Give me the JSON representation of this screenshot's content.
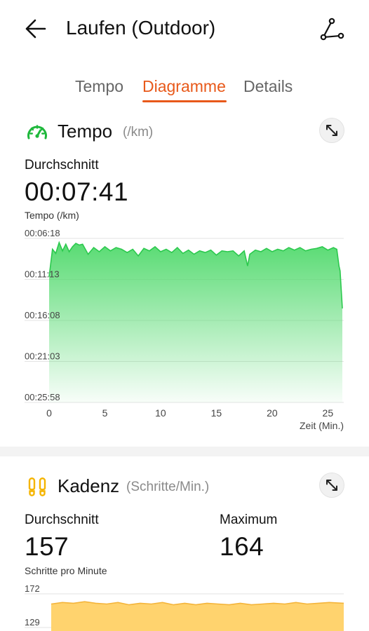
{
  "header": {
    "title": "Laufen (Outdoor)",
    "back_icon": "arrow-left-icon",
    "route_icon": "route-icon"
  },
  "tabs": [
    {
      "label": "Tempo",
      "active": false
    },
    {
      "label": "Diagramme",
      "active": true
    },
    {
      "label": "Details",
      "active": false
    }
  ],
  "accent_color": "#e8591a",
  "tempo": {
    "title": "Tempo",
    "unit": "(/km)",
    "icon": "speedometer-icon",
    "icon_color": "#1fb83c",
    "avg_label": "Durchschnitt",
    "avg_value": "00:07:41",
    "chart_label": "Tempo (/km)"
  },
  "kadenz": {
    "title": "Kadenz",
    "unit": "(Schritte/Min.)",
    "icon": "footprints-icon",
    "icon_color": "#f5b400",
    "avg_label": "Durchschnitt",
    "avg_value": "157",
    "max_label": "Maximum",
    "max_value": "164",
    "chart_label": "Schritte pro Minute"
  },
  "chart_data": [
    {
      "type": "area",
      "ylabel": "Tempo (/km)",
      "xlabel": "Zeit (Min.)",
      "y_ticks": [
        "00:06:18",
        "00:11:13",
        "00:16:08",
        "00:21:03",
        "00:25:58"
      ],
      "y_ticks_min": [
        6.3,
        11.217,
        16.133,
        21.05,
        25.967
      ],
      "x_ticks": [
        "0",
        "5",
        "10",
        "15",
        "20",
        "25"
      ],
      "x_ticks_values": [
        0,
        5,
        10,
        15,
        20,
        25
      ],
      "xlim": [
        0,
        26.3
      ],
      "y_inverted": true,
      "color": "#2cc94e",
      "x": [
        0,
        0.3,
        0.6,
        0.9,
        1.2,
        1.5,
        1.8,
        2.1,
        2.4,
        2.7,
        3.0,
        3.5,
        4.0,
        4.5,
        5.0,
        5.5,
        6.0,
        6.5,
        7.0,
        7.5,
        8.0,
        8.5,
        9.0,
        9.5,
        10.0,
        10.5,
        11.0,
        11.5,
        12.0,
        12.5,
        13.0,
        13.5,
        14.0,
        14.5,
        15.0,
        15.5,
        16.0,
        16.5,
        17.0,
        17.5,
        17.8,
        18.0,
        18.5,
        19.0,
        19.5,
        20.0,
        20.5,
        21.0,
        21.5,
        22.0,
        22.5,
        23.0,
        23.5,
        24.0,
        24.5,
        25.0,
        25.5,
        25.8,
        26.0,
        26.1,
        26.3
      ],
      "y": [
        10.9,
        7.6,
        8.1,
        6.8,
        7.8,
        7.0,
        7.9,
        7.3,
        6.9,
        7.1,
        7.0,
        8.2,
        7.4,
        7.9,
        7.3,
        7.8,
        7.4,
        7.6,
        8.0,
        7.6,
        8.4,
        7.5,
        7.8,
        7.3,
        7.9,
        7.6,
        8.0,
        7.4,
        8.1,
        7.7,
        8.2,
        7.8,
        8.0,
        7.7,
        8.3,
        7.8,
        7.9,
        7.8,
        8.4,
        7.8,
        9.6,
        8.2,
        7.7,
        7.9,
        7.5,
        7.9,
        7.6,
        7.8,
        7.4,
        7.7,
        7.4,
        7.8,
        7.6,
        7.5,
        7.3,
        7.7,
        7.4,
        7.6,
        9.6,
        10.2,
        14.7
      ]
    },
    {
      "type": "area",
      "ylabel": "Schritte pro Minute",
      "y_ticks": [
        "172",
        "129"
      ],
      "y_ticks_values": [
        172,
        129
      ],
      "xlim": [
        0,
        26.3
      ],
      "color": "#ffcf63",
      "x": [
        0,
        1,
        2,
        3,
        4,
        5,
        6,
        7,
        8,
        9,
        10,
        11,
        12,
        13,
        14,
        15,
        16,
        17,
        18,
        19,
        20,
        21,
        22,
        23,
        24,
        25,
        26.3
      ],
      "y": [
        159,
        161,
        160,
        162,
        160,
        159,
        161,
        158,
        160,
        159,
        161,
        158,
        160,
        158,
        160,
        159,
        158,
        160,
        158,
        159,
        160,
        159,
        161,
        159,
        160,
        161,
        160
      ]
    }
  ]
}
